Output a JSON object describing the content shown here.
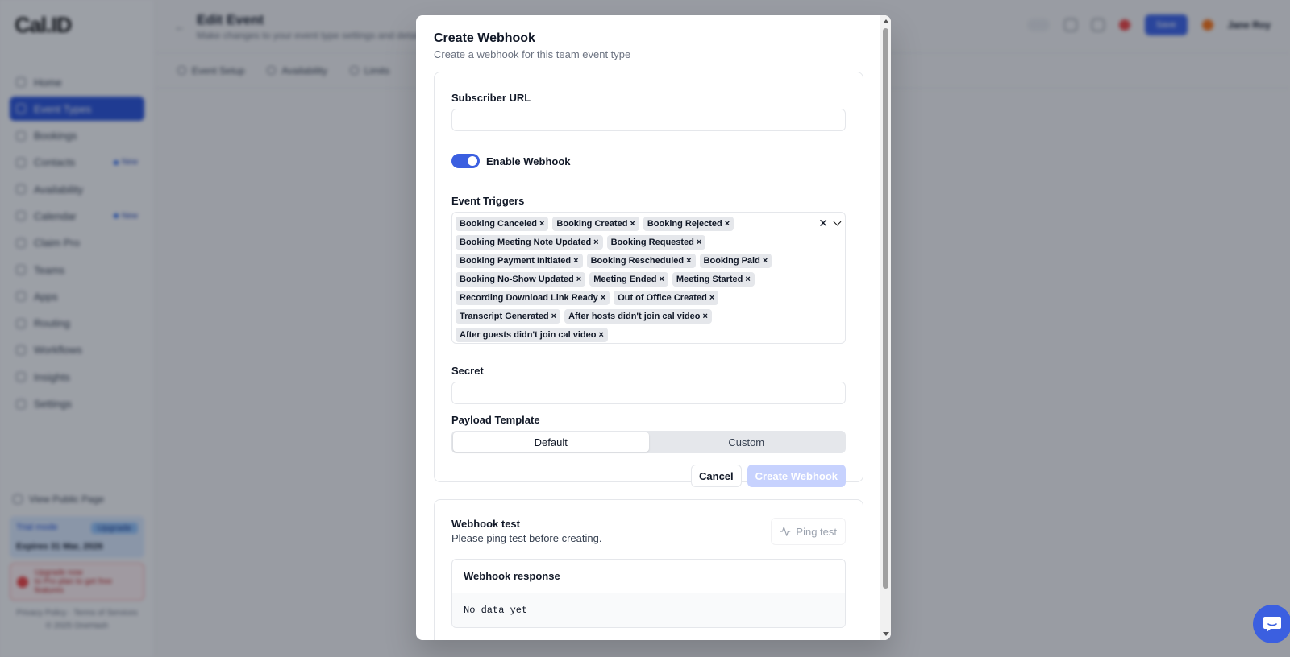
{
  "app": {
    "logo": "Cal.ID",
    "nav": [
      {
        "label": "Home",
        "badge": ""
      },
      {
        "label": "Event Types",
        "badge": ""
      },
      {
        "label": "Bookings",
        "badge": ""
      },
      {
        "label": "Contacts",
        "badge": "New"
      },
      {
        "label": "Availability",
        "badge": ""
      },
      {
        "label": "Calendar",
        "badge": "New"
      },
      {
        "label": "Claim Pro",
        "badge": ""
      },
      {
        "label": "Teams",
        "badge": ""
      },
      {
        "label": "Apps",
        "badge": ""
      },
      {
        "label": "Routing",
        "badge": ""
      },
      {
        "label": "Workflows",
        "badge": ""
      },
      {
        "label": "Insights",
        "badge": ""
      },
      {
        "label": "Settings",
        "badge": ""
      }
    ],
    "view_public_page": "View Public Page",
    "trial_label": "Trial mode",
    "trial_pill": "Upgrade",
    "trial_expiry": "Expires 31 Mar, 2026",
    "warning_line1": "Upgrade now",
    "warning_line2": "to Pro plan to get free features",
    "footer_links": "Privacy Policy · Terms of Services",
    "footer_copy": "© 2025 OneHash",
    "page_title": "Edit Event",
    "page_subtitle": "Make changes to your event type settings and details",
    "tabs": [
      "Event Setup",
      "Availability",
      "Limits"
    ],
    "save_label": "Save",
    "user_name": "Jane Roy"
  },
  "modal": {
    "title": "Create Webhook",
    "subtitle": "Create a webhook for this team event type",
    "subscriber_url": {
      "label": "Subscriber URL",
      "value": "",
      "placeholder": ""
    },
    "enable_webhook": {
      "label": "Enable Webhook",
      "enabled": true
    },
    "event_triggers": {
      "label": "Event Triggers",
      "selected": [
        "Booking Canceled",
        "Booking Created",
        "Booking Rejected",
        "Booking Meeting Note Updated",
        "Booking Requested",
        "Booking Payment Initiated",
        "Booking Rescheduled",
        "Booking Paid",
        "Booking No-Show Updated",
        "Meeting Ended",
        "Meeting Started",
        "Recording Download Link Ready",
        "Out of Office Created",
        "Transcript Generated",
        "After hosts didn't join cal video",
        "After guests didn't join cal video"
      ]
    },
    "secret": {
      "label": "Secret",
      "value": "",
      "placeholder": ""
    },
    "payload_template": {
      "label": "Payload Template",
      "options": [
        "Default",
        "Custom"
      ],
      "selected": "Default"
    },
    "cancel_label": "Cancel",
    "create_label": "Create Webhook",
    "webhook_test": {
      "title": "Webhook test",
      "subtitle": "Please ping test before creating.",
      "ping_label": "Ping test",
      "response_title": "Webhook response",
      "response_body": "No data yet"
    }
  },
  "colors": {
    "accent": "#3b5fe0",
    "disabled_accent": "#c7d2fe",
    "chip_bg": "#e5e7eb"
  }
}
